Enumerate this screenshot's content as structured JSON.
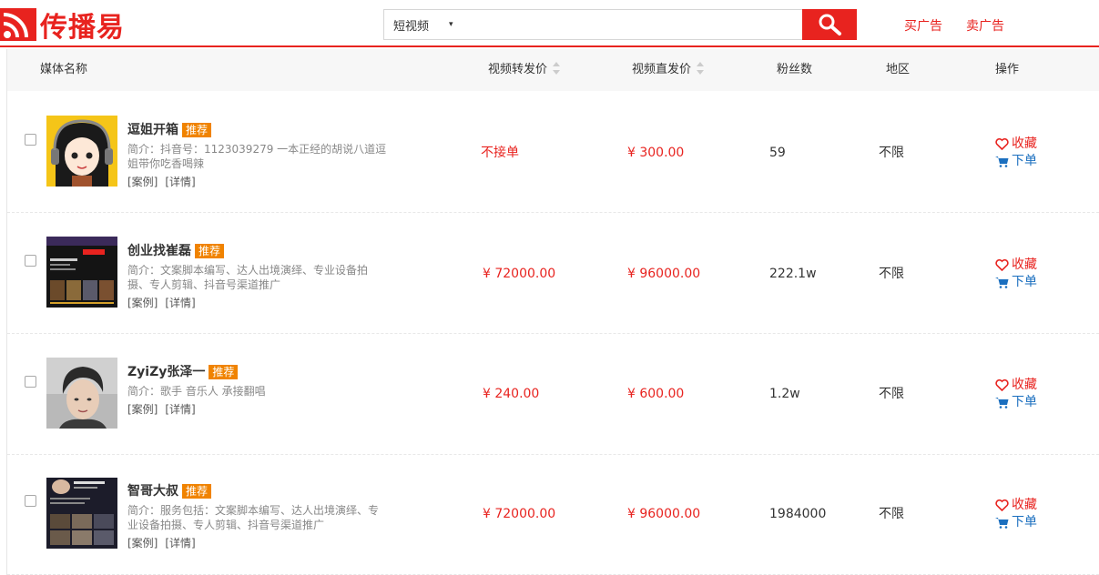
{
  "header": {
    "logo_text": "传播易",
    "search": {
      "category": "短视频",
      "caret": "▾",
      "placeholder": ""
    },
    "links": {
      "buy": "买广告",
      "sell": "卖广告"
    }
  },
  "table": {
    "columns": {
      "name": "媒体名称",
      "repost_price": "视频转发价",
      "direct_price": "视频直发价",
      "fans": "粉丝数",
      "region": "地区",
      "action": "操作"
    },
    "rows": [
      {
        "name": "逗姐开箱",
        "badge": "推荐",
        "desc": "简介：抖音号：1123039279 一本正经的胡说八道逗姐带你吃香喝辣",
        "case_link": "[案例]",
        "detail_link": "[详情]",
        "repost_price": "不接单",
        "direct_price": "¥ 300.00",
        "fans": "59",
        "region": "不限",
        "fav": "收藏",
        "order": "下单"
      },
      {
        "name": "创业找崔磊",
        "badge": "推荐",
        "desc": "简介：文案脚本编写、达人出境演绎、专业设备拍摄、专人剪辑、抖音号渠道推广",
        "case_link": "[案例]",
        "detail_link": "[详情]",
        "repost_price": "¥ 72000.00",
        "direct_price": "¥ 96000.00",
        "fans": "222.1w",
        "region": "不限",
        "fav": "收藏",
        "order": "下单"
      },
      {
        "name": "ZyiZy张泽一",
        "badge": "推荐",
        "desc": "简介：歌手 音乐人 承接翻唱",
        "case_link": "[案例]",
        "detail_link": "[详情]",
        "repost_price": "¥ 240.00",
        "direct_price": "¥ 600.00",
        "fans": "1.2w",
        "region": "不限",
        "fav": "收藏",
        "order": "下单"
      },
      {
        "name": "智哥大叔",
        "badge": "推荐",
        "desc": "简介：服务包括：文案脚本编写、达人出境演绎、专业设备拍摄、专人剪辑、抖音号渠道推广",
        "case_link": "[案例]",
        "detail_link": "[详情]",
        "repost_price": "¥ 72000.00",
        "direct_price": "¥ 96000.00",
        "fans": "1984000",
        "region": "不限",
        "fav": "收藏",
        "order": "下单"
      }
    ]
  },
  "colors": {
    "brand": "#e8231f",
    "badge": "#f08300",
    "order_link": "#1b6fbf"
  },
  "icons": {
    "search_button": "search-icon",
    "fav": "heart-icon",
    "order": "cart-icon",
    "logo": "rss-icon"
  }
}
